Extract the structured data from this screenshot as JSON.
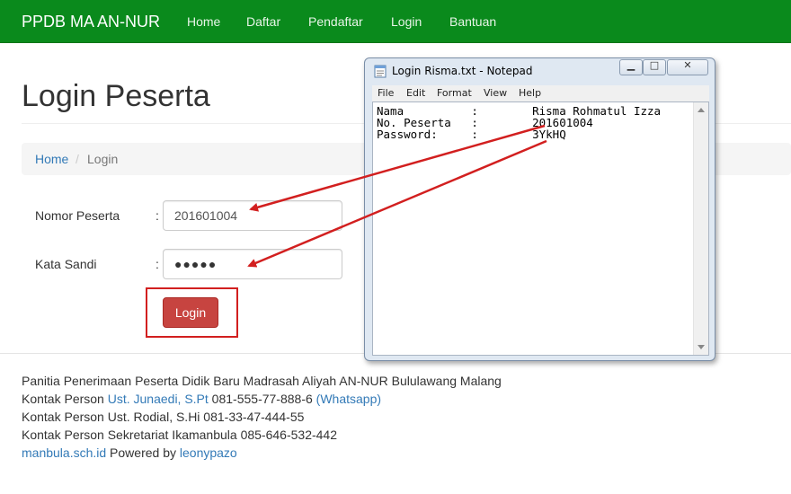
{
  "navbar": {
    "brand": "PPDB MA AN-NUR",
    "items": [
      "Home",
      "Daftar",
      "Pendaftar",
      "Login",
      "Bantuan"
    ]
  },
  "page": {
    "title": "Login Peserta"
  },
  "breadcrumb": {
    "home": "Home",
    "separator": "/",
    "current": "Login"
  },
  "form": {
    "nomor_label": "Nomor Peserta",
    "nomor_value": "201601004",
    "sandi_label": "Kata Sandi",
    "sandi_mask": "●●●●●",
    "colon": ":",
    "login_button": "Login"
  },
  "footer": {
    "line1": "Panitia Penerimaan Peserta Didik Baru Madrasah Aliyah AN-NUR Bululawang Malang",
    "line2_prefix": "Kontak Person ",
    "line2_link": "Ust. Junaedi, S.Pt",
    "line2_phone": " 081-555-77-888-6 ",
    "line2_whatsapp": "(Whatsapp)",
    "line3": "Kontak Person Ust. Rodial, S.Hi 081-33-47-444-55",
    "line4": "Kontak Person Sekretariat Ikamanbula 085-646-532-442",
    "line5_link": "manbula.sch.id",
    "line5_text": " Powered by ",
    "line5_author": "leonypazo"
  },
  "notepad": {
    "title": "Login Risma.txt - Notepad",
    "menu": [
      "File",
      "Edit",
      "Format",
      "View",
      "Help"
    ],
    "lines": [
      "Nama          :        Risma Rohmatul Izza",
      "No. Peserta   :        201601004",
      "Password:     :        3YkHQ"
    ],
    "controls": {
      "minimize": "▁",
      "maximize": "□",
      "close": "✕"
    }
  },
  "colors": {
    "navbar": "#0a8a1c",
    "link": "#337ab7",
    "button": "#c74440",
    "annotation": "#d21f1f"
  }
}
